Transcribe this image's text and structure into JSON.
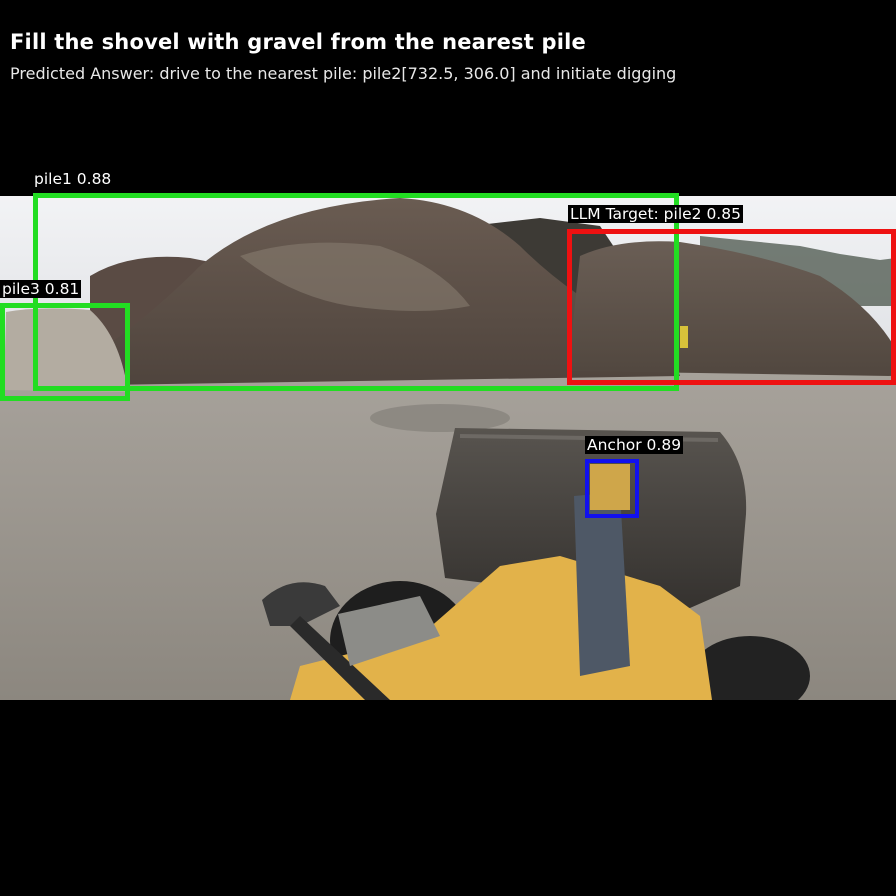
{
  "header": {
    "title": "Fill the shovel with gravel from the nearest pile",
    "predicted_answer": "Predicted Answer: drive to the nearest pile: pile2[732.5, 306.0] and initiate digging"
  },
  "detections": {
    "pile1": {
      "label": "pile1 0.88",
      "color": "#22dd22"
    },
    "pile2": {
      "label": "LLM Target: pile2 0.85",
      "color": "#ee1111"
    },
    "pile3": {
      "label": "pile3 0.81",
      "color": "#22dd22"
    },
    "anchor": {
      "label": "Anchor 0.89",
      "color": "#1111ee"
    }
  },
  "scene": {
    "description_icon": "wheel-loader-camera-view"
  }
}
